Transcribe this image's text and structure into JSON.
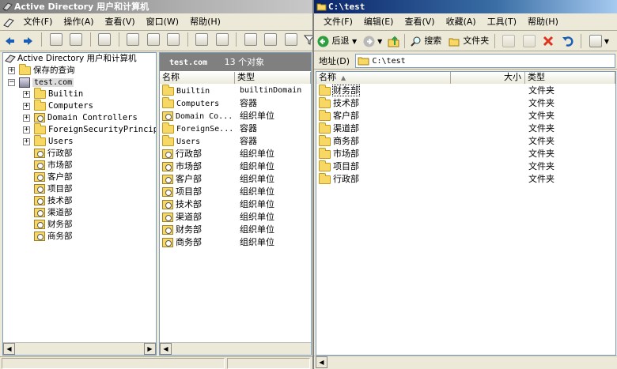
{
  "ad": {
    "title": "Active Directory 用户和计算机",
    "menu": [
      "文件(F)",
      "操作(A)",
      "查看(V)",
      "窗口(W)",
      "帮助(H)"
    ],
    "tree": {
      "root": "Active Directory 用户和计算机",
      "saved_queries": "保存的查询",
      "domain": "test.com",
      "containers": [
        "Builtin",
        "Computers",
        "Domain Controllers",
        "ForeignSecurityPrincipa",
        "Users"
      ],
      "ous": [
        "行政部",
        "市场部",
        "客户部",
        "项目部",
        "技术部",
        "渠道部",
        "财务部",
        "商务部"
      ]
    },
    "list": {
      "header_title": "test.com",
      "header_count": "13 个对象",
      "col_name": "名称",
      "col_type": "类型",
      "rows": [
        {
          "name": "Builtin",
          "type": "builtinDomain"
        },
        {
          "name": "Computers",
          "type": "容器"
        },
        {
          "name": "Domain Co...",
          "type": "组织单位"
        },
        {
          "name": "ForeignSe...",
          "type": "容器"
        },
        {
          "name": "Users",
          "type": "容器"
        },
        {
          "name": "行政部",
          "type": "组织单位"
        },
        {
          "name": "市场部",
          "type": "组织单位"
        },
        {
          "name": "客户部",
          "type": "组织单位"
        },
        {
          "name": "项目部",
          "type": "组织单位"
        },
        {
          "name": "技术部",
          "type": "组织单位"
        },
        {
          "name": "渠道部",
          "type": "组织单位"
        },
        {
          "name": "财务部",
          "type": "组织单位"
        },
        {
          "name": "商务部",
          "type": "组织单位"
        }
      ]
    }
  },
  "explorer": {
    "title": "C:\\test",
    "menu": [
      "文件(F)",
      "编辑(E)",
      "查看(V)",
      "收藏(A)",
      "工具(T)",
      "帮助(H)"
    ],
    "toolbar": {
      "back": "后退",
      "search": "搜索",
      "folders": "文件夹"
    },
    "address_label": "地址(D)",
    "address_value": "C:\\test",
    "columns": {
      "name": "名称",
      "size": "大小",
      "type": "类型"
    },
    "files": [
      {
        "name": "财务部",
        "type": "文件夹"
      },
      {
        "name": "技术部",
        "type": "文件夹"
      },
      {
        "name": "客户部",
        "type": "文件夹"
      },
      {
        "name": "渠道部",
        "type": "文件夹"
      },
      {
        "name": "商务部",
        "type": "文件夹"
      },
      {
        "name": "市场部",
        "type": "文件夹"
      },
      {
        "name": "项目部",
        "type": "文件夹"
      },
      {
        "name": "行政部",
        "type": "文件夹"
      }
    ]
  },
  "colors": {
    "ad_titlebar": "#7a7a7a",
    "explorer_titlebar": "#0a246a",
    "list_header": "#808080"
  }
}
